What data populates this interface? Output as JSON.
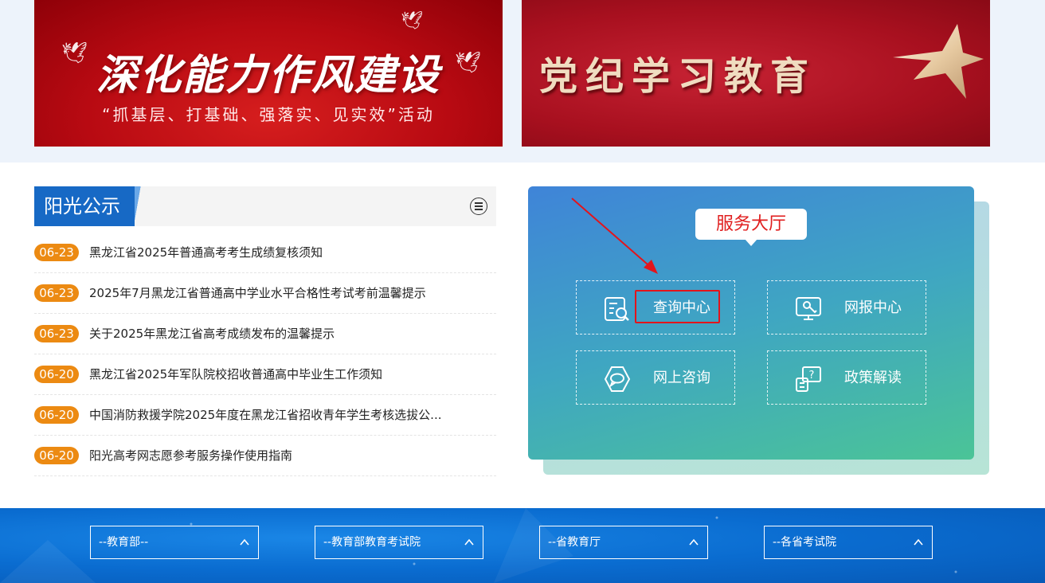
{
  "banners": {
    "left": {
      "title": "深化能力作风建设",
      "subtitle": "“抓基层、打基础、强落实、见实效”活动"
    },
    "right": {
      "title": "党纪学习教育"
    }
  },
  "notices": {
    "title": "阳光公示",
    "items": [
      {
        "date": "06-23",
        "title": "黑龙江省2025年普通高考考生成绩复核须知"
      },
      {
        "date": "06-23",
        "title": "2025年7月黑龙江省普通高中学业水平合格性考试考前温馨提示"
      },
      {
        "date": "06-23",
        "title": "关于2025年黑龙江省高考成绩发布的温馨提示"
      },
      {
        "date": "06-20",
        "title": "黑龙江省2025年军队院校招收普通高中毕业生工作须知"
      },
      {
        "date": "06-20",
        "title": "中国消防救援学院2025年度在黑龙江省招收青年学生考核选拔公..."
      },
      {
        "date": "06-20",
        "title": "阳光高考网志愿参考服务操作使用指南"
      }
    ]
  },
  "service_hall": {
    "title": "服务大厅",
    "services": [
      {
        "label": "查询中心",
        "icon": "search-document-icon"
      },
      {
        "label": "网报中心",
        "icon": "online-register-icon"
      },
      {
        "label": "网上咨询",
        "icon": "chat-bubble-icon"
      },
      {
        "label": "政策解读",
        "icon": "question-document-icon"
      }
    ]
  },
  "footer": {
    "selects": [
      {
        "value": "--教育部--"
      },
      {
        "value": "--教育部教育考试院"
      },
      {
        "value": "--省教育厅"
      },
      {
        "value": "--各省考试院"
      }
    ]
  },
  "colors": {
    "accent_blue": "#1769c5",
    "date_badge": "#ec8a12",
    "highlight_red": "#e3141b",
    "hall_title_red": "#e01e1e"
  }
}
